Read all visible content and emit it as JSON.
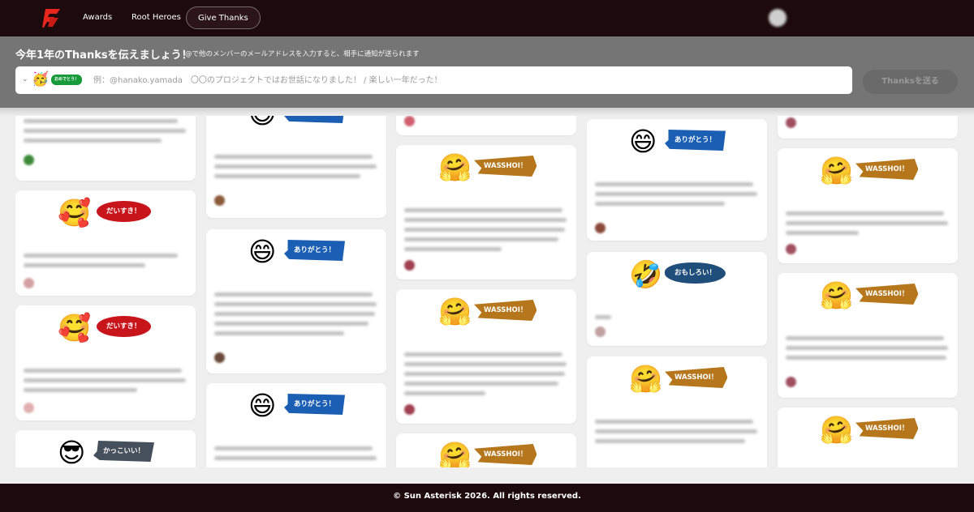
{
  "nav": {
    "items": [
      {
        "label": "Awards"
      },
      {
        "label": "Root Heroes"
      },
      {
        "label": "Give Thanks",
        "active": true
      }
    ],
    "logo_icon": "sun-asterisk-logo-icon",
    "user_avatar_icon": "user-avatar-icon"
  },
  "composer": {
    "title": "今年1年のThanksを伝えましょう！",
    "hint": "@で他のメンバーのメールアドレスを入力すると、相手に通知が送られます",
    "placeholder": "例：@hanako.yamada　〇〇のプロジェクトではお世話になりました！ / 楽しい一年だった！",
    "selected_stamp": {
      "emoji": "🥳",
      "label": "おめでとう！"
    },
    "chevron_icon": "chevron-down-icon",
    "send_label": "Thanksを送る"
  },
  "stamps": {
    "arigato": {
      "emoji": "😄",
      "label": "ありがとう！",
      "color": "#1a5fb4"
    },
    "wasshoi": {
      "emoji": "🤗",
      "label": "WASSHOI！",
      "color": "#b5761c"
    },
    "daisuki": {
      "emoji": "🥰",
      "label": "だいすき！",
      "color": "#c8151b"
    },
    "omoshiroi": {
      "emoji": "🤣",
      "label": "おもしろい！",
      "color": "#1f4e7a"
    },
    "kakkoii": {
      "emoji": "😎",
      "label": "かっこいい！",
      "color": "#46505d"
    }
  },
  "footer": {
    "copyright": "© Sun Asterisk 2026. All rights reserved."
  }
}
